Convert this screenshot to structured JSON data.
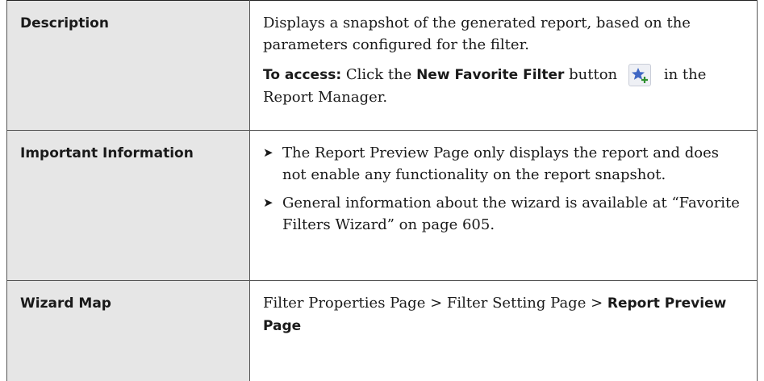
{
  "rows": [
    {
      "label": "Description",
      "para1": "Displays a snapshot of the generated report, based on the parameters configured for the filter.",
      "access_prefix": "To access:",
      "access_text1": " Click the ",
      "access_button": "New Favorite Filter",
      "access_text2": " button",
      "access_text3": " in the Report Manager.",
      "icon": "new-favorite-filter-star-icon"
    },
    {
      "label": "Important Information",
      "bullets": [
        "The Report Preview Page only displays the report and does not enable any functionality on the report snapshot.",
        "General information about the wizard is available at “Favorite Filters Wizard” on page 605."
      ]
    },
    {
      "label": "Wizard Map",
      "map_part1": "Filter Properties Page > Filter Setting Page > ",
      "map_part2": "Report Preview Page"
    }
  ],
  "colors": {
    "label_bg": "#e6e6e6",
    "border": "#555555",
    "star": "#3f67c4"
  }
}
